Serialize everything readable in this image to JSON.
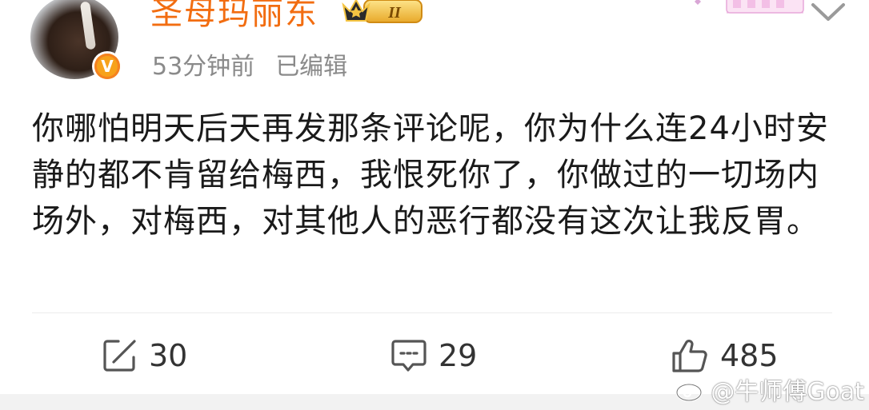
{
  "post": {
    "username": "圣母玛丽东",
    "vip_level": "II",
    "verified_badge": "V",
    "timestamp": "53分钟前",
    "edited_label": "已编辑",
    "content": "你哪怕明天后天再发那条评论呢，你为什么连24小时安静的都不肯留给梅西，我恨死你了，你做过的一切场内场外，对梅西，对其他人的恶行都没有这次让我反胃。"
  },
  "actions": {
    "repost_count": "30",
    "comment_count": "29",
    "like_count": "485"
  },
  "watermark": {
    "text": "@牛师傅Goat"
  },
  "icons": {
    "repost": "repost-icon",
    "comment": "comment-icon",
    "like": "thumbs-up-icon",
    "more": "chevron-down-icon",
    "weibo": "weibo-logo-icon"
  },
  "colors": {
    "username": "#f26d11",
    "verified": "#f7a21b",
    "meta_text": "#8a8a8a",
    "body_text": "#1a1a1a"
  }
}
